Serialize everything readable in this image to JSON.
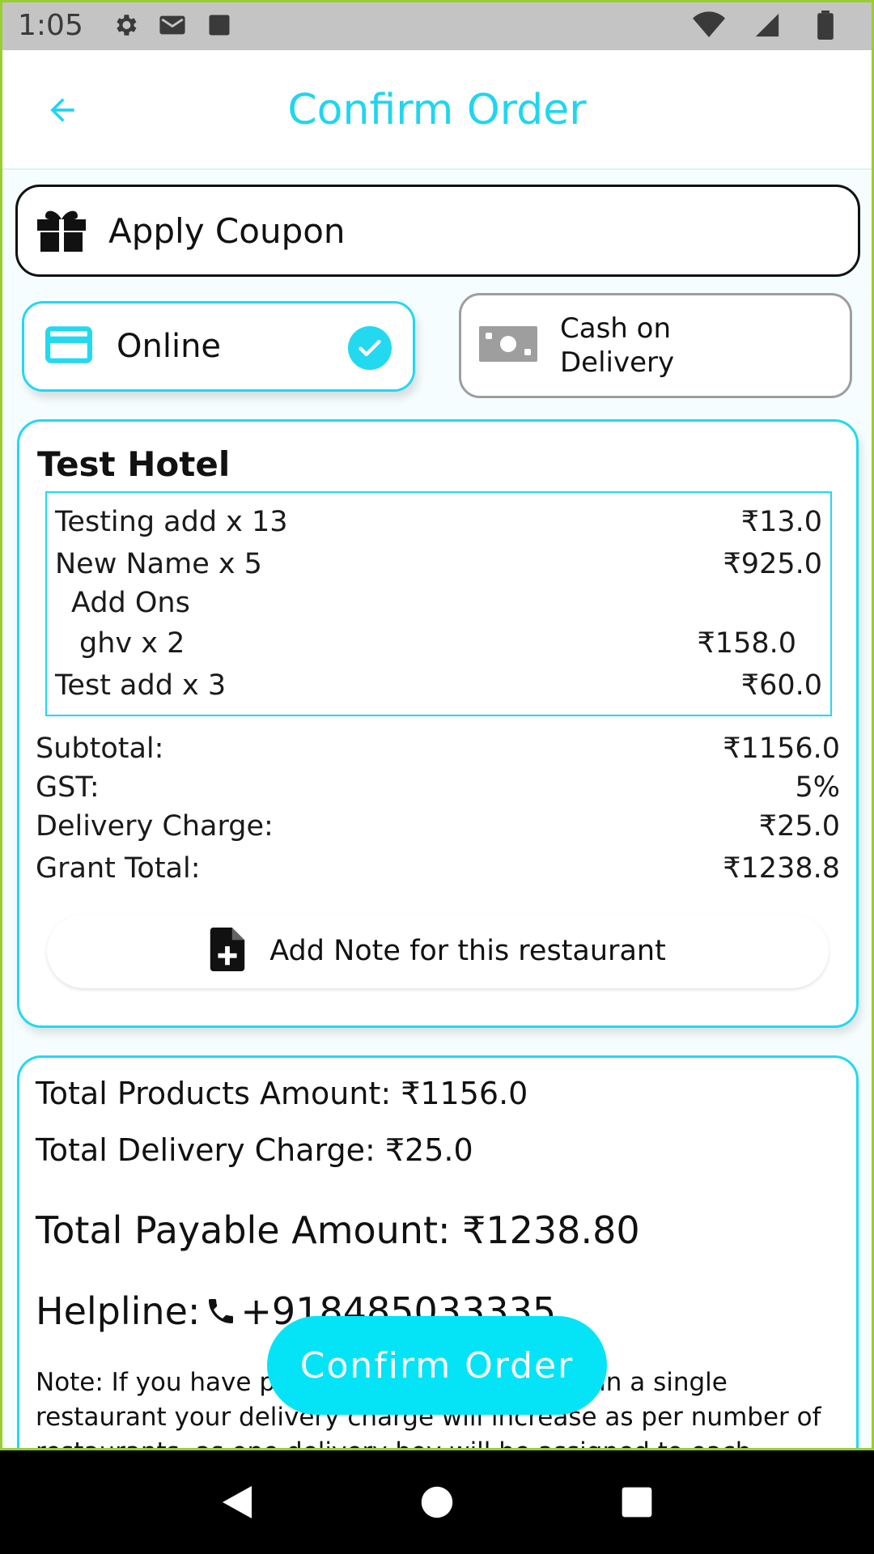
{
  "status_bar": {
    "time": "1:05",
    "icons": [
      "gear-icon",
      "mail-icon",
      "square-icon",
      "wifi-icon",
      "signal-icon",
      "battery-icon"
    ]
  },
  "app_bar": {
    "title": "Confirm Order",
    "back_icon": "arrow-back-icon"
  },
  "coupon": {
    "label": "Apply Coupon",
    "icon": "gift-icon"
  },
  "payment": {
    "online_label": "Online",
    "cod_label_line1": "Cash on",
    "cod_label_line2": "Delivery",
    "selected": "Online"
  },
  "restaurant": {
    "name": "Test Hotel",
    "items": [
      {
        "label": "Testing add x 13",
        "price": "₹13.0"
      },
      {
        "label": "New Name x 5",
        "price": "₹925.0"
      }
    ],
    "addons_heading": "Add Ons",
    "addons": [
      {
        "label": "ghv x 2",
        "price": "₹158.0"
      }
    ],
    "items_after": [
      {
        "label": "Test add x 3",
        "price": "₹60.0"
      }
    ],
    "summary": {
      "subtotal_label": "Subtotal:",
      "subtotal_value": "₹1156.0",
      "gst_label": "GST:",
      "gst_value": "5%",
      "delivery_label": "Delivery Charge:",
      "delivery_value": "₹25.0",
      "grand_label": "Grant Total:",
      "grand_value": "₹1238.8"
    },
    "note_button_label": "Add Note for this restaurant"
  },
  "totals": {
    "products": "Total Products Amount: ₹1156.0",
    "delivery": "Total Delivery Charge: ₹25.0",
    "payable": "Total Payable Amount: ₹1238.80",
    "helpline_label": "Helpline:",
    "helpline_number": "+918485033335",
    "note": "Note: If you have placed order from more than a single restaurant your delivery charge will increase as per number of restaurants, as one delivery boy will be assigned to each restaurant."
  },
  "confirm_button": "Confirm Order",
  "colors": {
    "accent": "#22d9f0",
    "button": "#05e4f6",
    "title": "#1fd6ef"
  }
}
